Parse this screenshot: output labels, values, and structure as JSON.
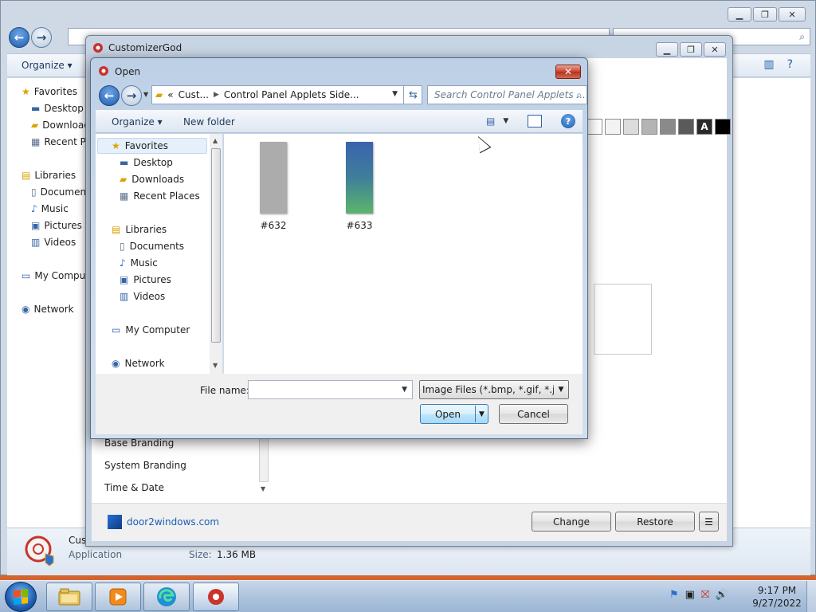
{
  "explorer": {
    "toolbar": {
      "organize": "Organize"
    },
    "nav": [
      {
        "label": "Favorites",
        "icon": "star-icon"
      },
      {
        "label": "Desktop",
        "icon": "desktop-icon"
      },
      {
        "label": "Downloads",
        "icon": "folder-icon"
      },
      {
        "label": "Recent Places",
        "icon": "recent-icon"
      },
      {
        "label": "Libraries",
        "icon": "library-icon"
      },
      {
        "label": "Documents",
        "icon": "document-icon"
      },
      {
        "label": "Music",
        "icon": "music-icon"
      },
      {
        "label": "Pictures",
        "icon": "pictures-icon"
      },
      {
        "label": "Videos",
        "icon": "videos-icon"
      },
      {
        "label": "My Computer",
        "icon": "computer-icon"
      },
      {
        "label": "Network",
        "icon": "network-icon"
      }
    ],
    "details": {
      "name": "Cus",
      "kind": "Application",
      "size_label": "Size:",
      "size_value": "1.36 MB"
    }
  },
  "customizer": {
    "title": "CustomizerGod",
    "categories": [
      "Base Branding",
      "System Branding",
      "Time & Date"
    ],
    "footer": {
      "link": "door2windows.com",
      "change": "Change",
      "restore": "Restore",
      "menu": "☰"
    },
    "swatches": [
      "#ffffff",
      "#f3f3f3",
      "#dcdcdc",
      "#b4b4b4",
      "#8a8a8a",
      "#5a5a5a",
      "#2a2a2a",
      "#000000"
    ],
    "swatch_letter": "A"
  },
  "dialog": {
    "title": "Open",
    "close": "✕",
    "address": {
      "prefix": "«",
      "crumbs": [
        "Cust...",
        "Control Panel Applets Side..."
      ]
    },
    "search_placeholder": "Search Control Panel Applets ...",
    "toolbar": {
      "organize": "Organize ▾",
      "new_folder": "New folder"
    },
    "nav": {
      "favorites": "Favorites",
      "favorites_items": [
        "Desktop",
        "Downloads",
        "Recent Places"
      ],
      "libraries": "Libraries",
      "libraries_items": [
        "Documents",
        "Music",
        "Pictures",
        "Videos"
      ],
      "computer": "My Computer",
      "network": "Network"
    },
    "files": [
      {
        "label": "#632",
        "kind": "gray"
      },
      {
        "label": "#633",
        "kind": "gradient"
      }
    ],
    "filename_label": "File name:",
    "filename_value": "",
    "filetype": "Image Files (*.bmp, *.gif, *.jpg,",
    "open": "Open",
    "cancel": "Cancel"
  },
  "taskbar": {
    "time": "9:17 PM",
    "date": "9/27/2022",
    "apps": [
      "explorer-icon",
      "media-player-icon",
      "edge-icon",
      "customizergod-icon"
    ]
  }
}
